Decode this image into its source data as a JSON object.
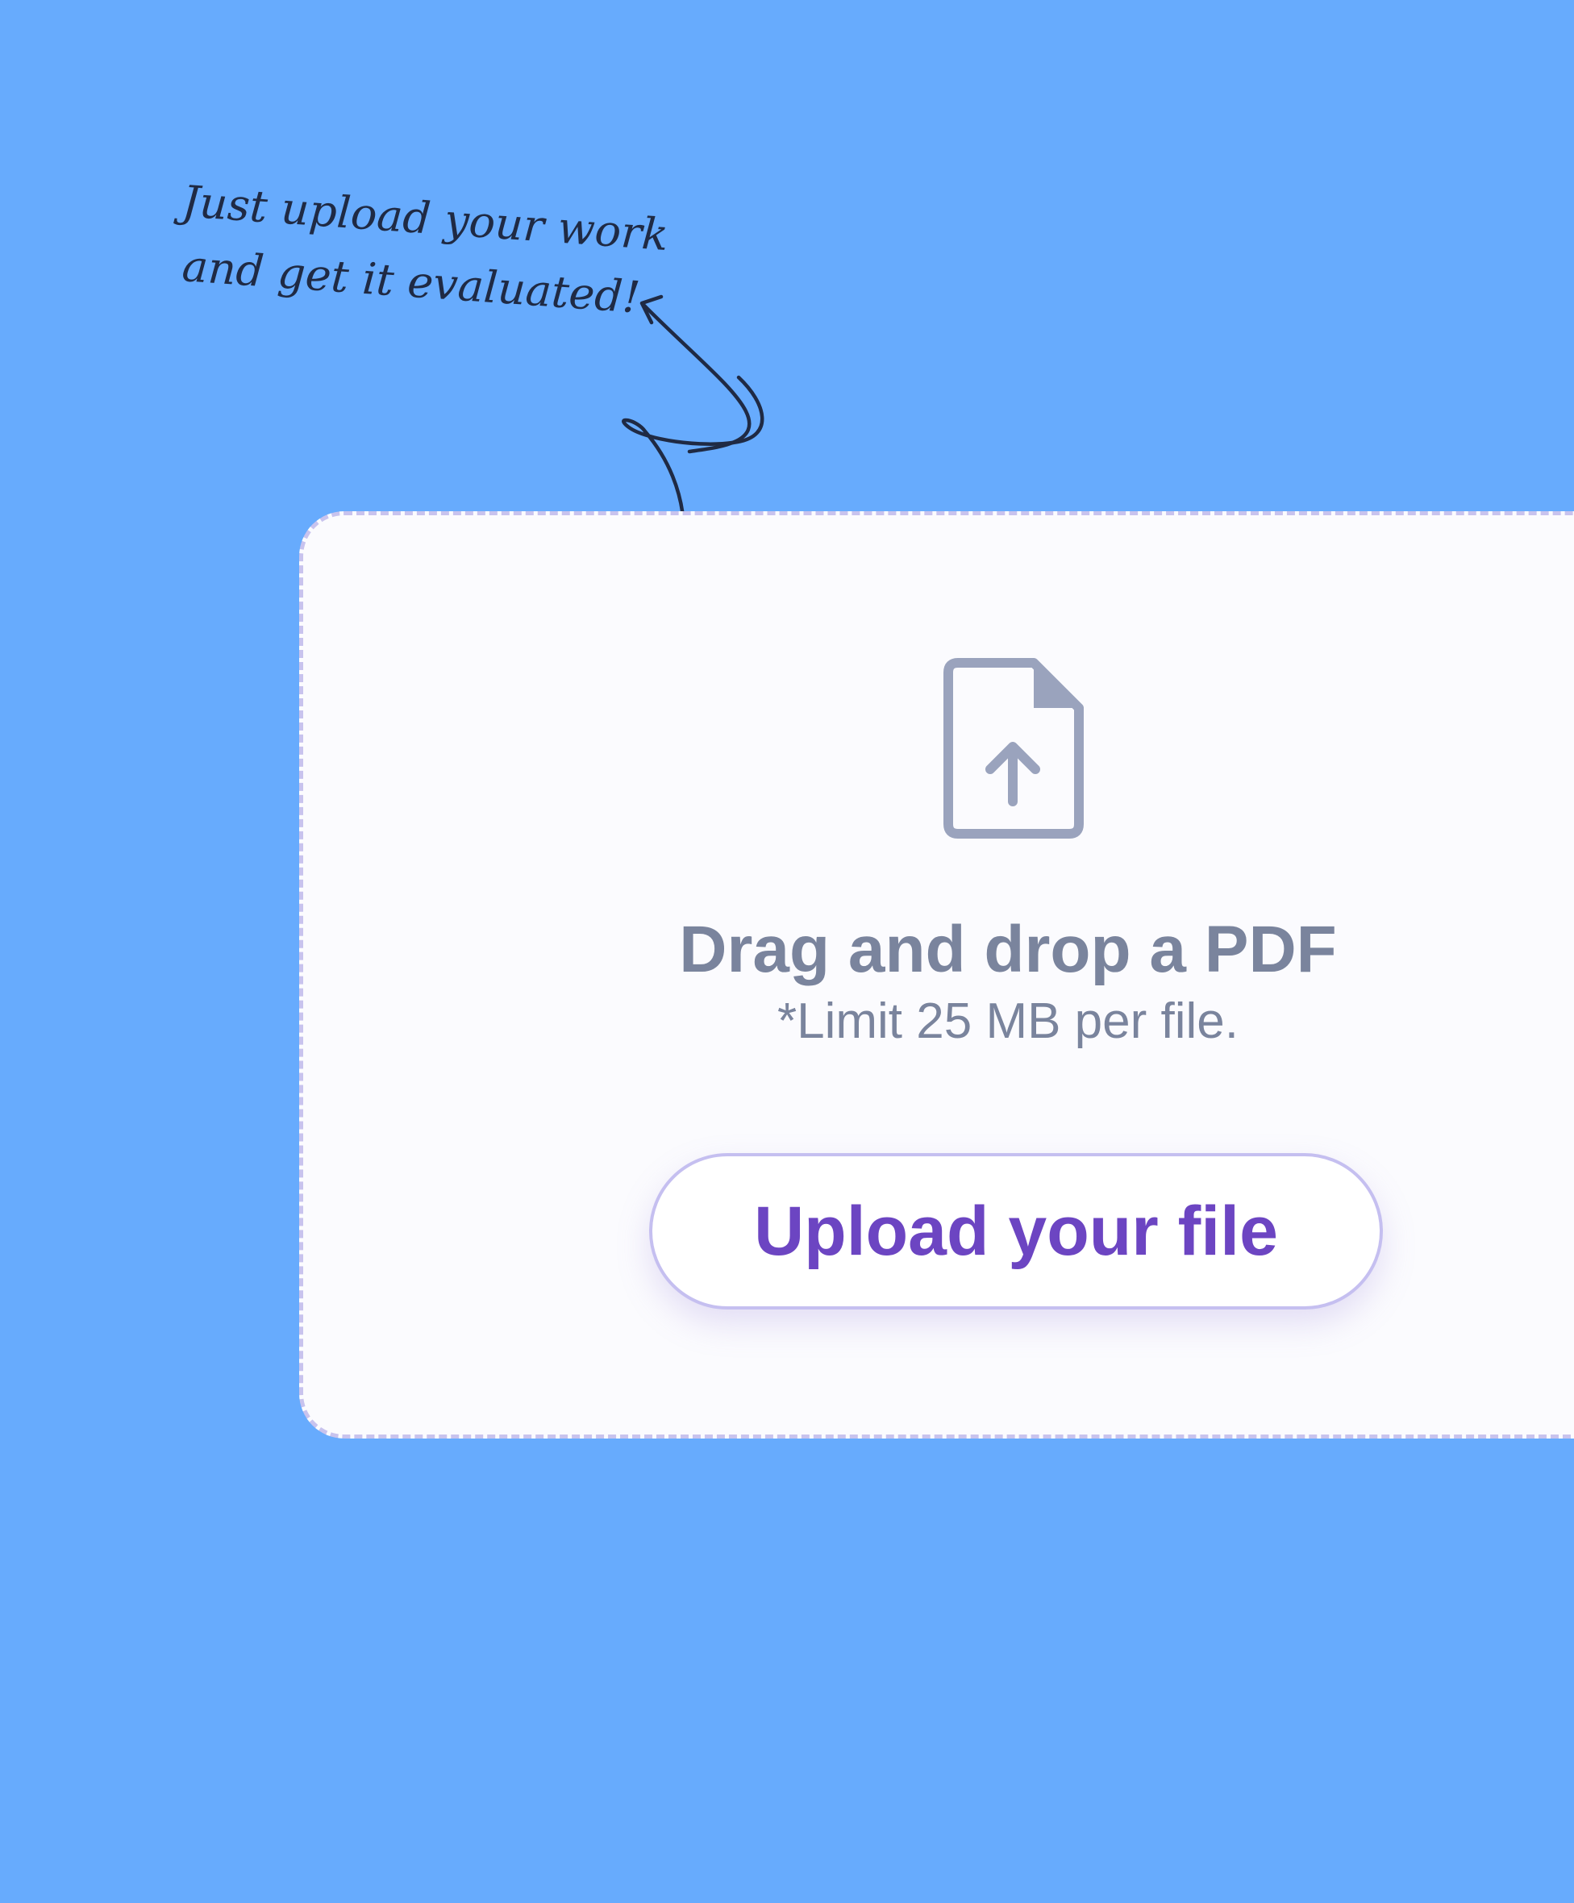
{
  "annotation": {
    "line1": "Just upload your work",
    "line2": "and get it evaluated!"
  },
  "dropzone": {
    "icon": "file-upload-icon",
    "title": "Drag and drop a PDF",
    "limit": "*Limit 25 MB per file.",
    "button_label": "Upload your file"
  },
  "colors": {
    "background": "#67abfd",
    "card": "#fbfbfe",
    "dashed_border": "#c8c3ee",
    "muted_text": "#7a849d",
    "icon": "#9aa3bd",
    "button_text": "#6c45c2",
    "button_border": "#c5bff0"
  }
}
